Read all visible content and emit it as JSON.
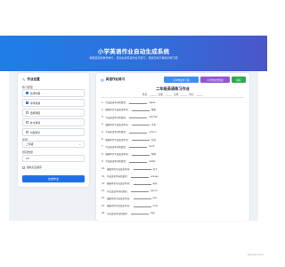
{
  "header": {
    "title": "小学英语作业自动生成系统",
    "subtitle": "根据选定的教学单元，自动生成英语作业与练习，便捷高效不重复的练习题"
  },
  "settings": {
    "title": "作业设置",
    "type_label": "练习题型",
    "options": [
      {
        "label": "英译中题",
        "checked": true
      },
      {
        "label": "中译英题",
        "checked": true
      },
      {
        "label": "选择题目",
        "checked": false
      },
      {
        "label": "补全单词",
        "checked": false
      },
      {
        "label": "句型填空",
        "checked": false
      }
    ],
    "grade_label": "年级",
    "grade_value": "二年级",
    "count_label": "题目数量",
    "count_value": "20",
    "shuffle_label": "随机打乱顺序",
    "generate_button": "生成作业"
  },
  "worksheet": {
    "title": "英语作业练习",
    "btn_print": "打印作业并下载",
    "btn_answer": "打印作业含答案",
    "btn_save": "保存",
    "sheet_title": "二年级英语练习作业",
    "fields": "姓名：______ 班级：______ 日期：______ 得分：______",
    "questions": [
      {
        "n": "1.",
        "text": "写出英语单词的意思：",
        "word": "apple"
      },
      {
        "n": "2.",
        "text": "根据中文写出英语单词：",
        "word": "猫咪"
      },
      {
        "n": "3.",
        "text": "写出英语单词的意思：",
        "word": "teacher"
      },
      {
        "n": "4.",
        "text": "根据中文写出英语单词：",
        "word": "书本"
      },
      {
        "n": "5.",
        "text": "写出英语单词的意思：",
        "word": "school"
      },
      {
        "n": "6.",
        "text": "根据中文写出英语单词：",
        "word": "红色"
      },
      {
        "n": "7.",
        "text": "写出英语单词的意思：",
        "word": "book"
      },
      {
        "n": "8.",
        "text": "根据中文写出英语单词：",
        "word": "狗狗"
      },
      {
        "n": "9.",
        "text": "写出英语单词的意思：",
        "word": "water"
      },
      {
        "n": "10.",
        "text": "根据中文写出英语单词：",
        "word": "桌子"
      },
      {
        "n": "11.",
        "text": "写出英语单词的意思：",
        "word": "orange"
      },
      {
        "n": "12.",
        "text": "根据中文写出英语单词：",
        "word": "妈妈"
      },
      {
        "n": "13.",
        "text": "写出英语单词的意思：",
        "word": "pencil"
      },
      {
        "n": "14.",
        "text": "根据中文写出英语单词：",
        "word": "pen"
      },
      {
        "n": "15.",
        "text": "根据中文写出英语单词：",
        "word": "ruler"
      },
      {
        "n": "16.",
        "text": "写出英语单词的意思：",
        "word": "bag"
      }
    ]
  },
  "watermark": "Zixuen.Com",
  "colors": {
    "primary": "#1f7ee8",
    "purple": "#9155d6",
    "green": "#2fa84f"
  }
}
